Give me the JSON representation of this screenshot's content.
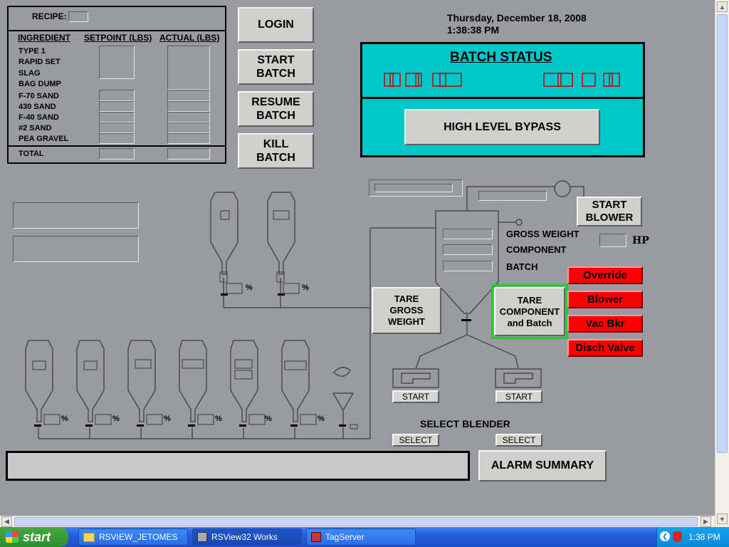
{
  "recipe": {
    "label": "RECIPE:",
    "headers": {
      "ingredient": "INGREDIENT",
      "setpoint": "SETPOINT (LBS)",
      "actual": "ACTUAL (LBS)"
    },
    "ingredients": [
      "TYPE 1",
      "RAPID SET",
      "SLAG",
      "BAG DUMP",
      "F-70 SAND",
      "430 SAND",
      "F-40 SAND",
      "#2 SAND",
      "PEA GRAVEL"
    ],
    "total_label": "TOTAL"
  },
  "controls": {
    "login": "LOGIN",
    "start_batch": "START\nBATCH",
    "resume_batch": "RESUME\nBATCH",
    "kill_batch": "KILL\nBATCH"
  },
  "datetime": {
    "date": "Thursday, December 18, 2008",
    "time": "1:38:38 PM"
  },
  "batch_status": {
    "title": "BATCH STATUS",
    "high_level_bypass": "HIGH LEVEL BYPASS"
  },
  "process": {
    "start_blower": "START\nBLOWER",
    "hp_label": "HP",
    "gross_weight": "GROSS WEIGHT",
    "component": "COMPONENT",
    "batch": "BATCH",
    "tare_gross": "TARE\nGROSS\nWEIGHT",
    "tare_component": "TARE\nCOMPONENT\nand Batch",
    "percent": "%",
    "start": "START",
    "select_blender": "SELECT BLENDER",
    "select": "SELECT",
    "alarm_summary": "ALARM SUMMARY"
  },
  "indicators": {
    "override": "Override",
    "blower": "Blower",
    "vac_bkr": "Vac Bkr",
    "disch_valve": "Disch Valve"
  },
  "taskbar": {
    "start": "start",
    "items": [
      "RSVIEW_JETOMES",
      "RSView32 Works",
      "TagServer"
    ],
    "clock": "1:38 PM"
  },
  "colors": {
    "panel_bg": "#9a9aa2",
    "status_cyan": "#00c8c8",
    "alarm_red": "#ff0000",
    "highlight_green": "#22cc22"
  }
}
